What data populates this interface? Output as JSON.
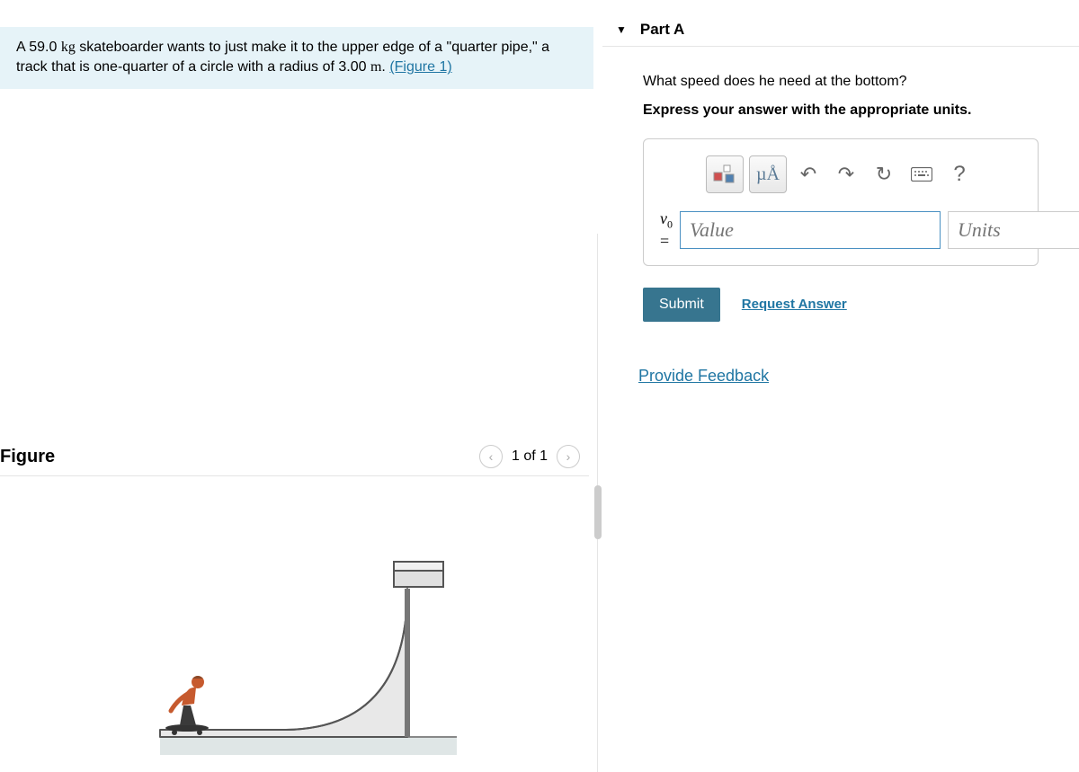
{
  "problem": {
    "text_1": "A 59.0 ",
    "unit_1": "kg",
    "text_2": " skateboarder wants to just make it to the upper edge of a \"quarter pipe,\" a track that is one-quarter of a circle with a radius of 3.00 ",
    "unit_2": "m",
    "text_3": ". ",
    "figure_link": "(Figure 1)"
  },
  "figure": {
    "title": "Figure",
    "page": "1 of 1"
  },
  "part": {
    "label": "Part A",
    "question": "What speed does he need at the bottom?",
    "instruction": "Express your answer with the appropriate units.",
    "toolbar": {
      "templates_label": "templates",
      "symbols_label": "µÅ",
      "undo_label": "undo",
      "redo_label": "redo",
      "reset_label": "reset",
      "keyboard_label": "keyboard",
      "help_label": "?"
    },
    "variable": "v",
    "variable_sub": "0",
    "equals": " = ",
    "value_placeholder": "Value",
    "units_placeholder": "Units",
    "submit": "Submit",
    "request_answer": "Request Answer",
    "feedback": "Provide Feedback"
  }
}
